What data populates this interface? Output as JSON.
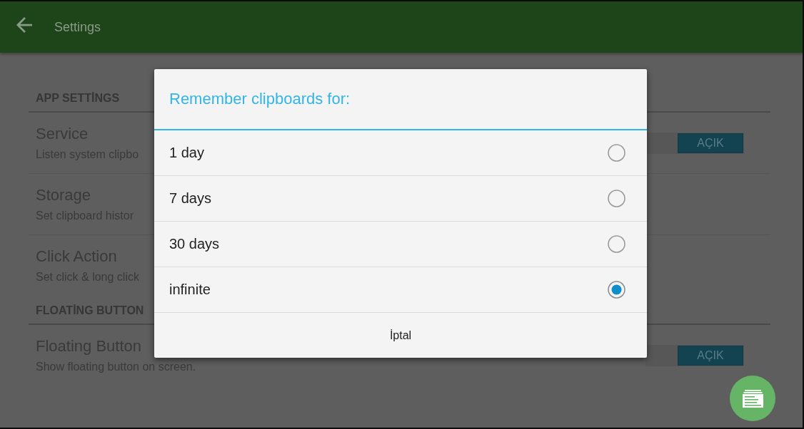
{
  "app_bar": {
    "title": "Settings"
  },
  "settings": [
    {
      "kind": "header",
      "title": "APP SETTİNGS"
    },
    {
      "kind": "toggle",
      "title": "Service",
      "summary": "Listen system clipbo",
      "switch": {
        "label": "AÇIK",
        "on": true
      }
    },
    {
      "kind": "item",
      "title": "Storage",
      "summary": "Set clipboard histor"
    },
    {
      "kind": "item",
      "title": "Click Action",
      "summary": "Set click & long click"
    },
    {
      "kind": "header",
      "title": "FLOATİNG BUTTON"
    },
    {
      "kind": "toggle",
      "title": "Floating Button",
      "summary": "Show floating button on screen.",
      "switch": {
        "label": "AÇIK",
        "on": true
      }
    }
  ],
  "dialog": {
    "title": "Remember clipboards for:",
    "options": [
      {
        "label": "1 day",
        "selected": false
      },
      {
        "label": "7 days",
        "selected": false
      },
      {
        "label": "30 days",
        "selected": false
      },
      {
        "label": "infinite",
        "selected": true
      }
    ],
    "cancel": "İptal"
  }
}
